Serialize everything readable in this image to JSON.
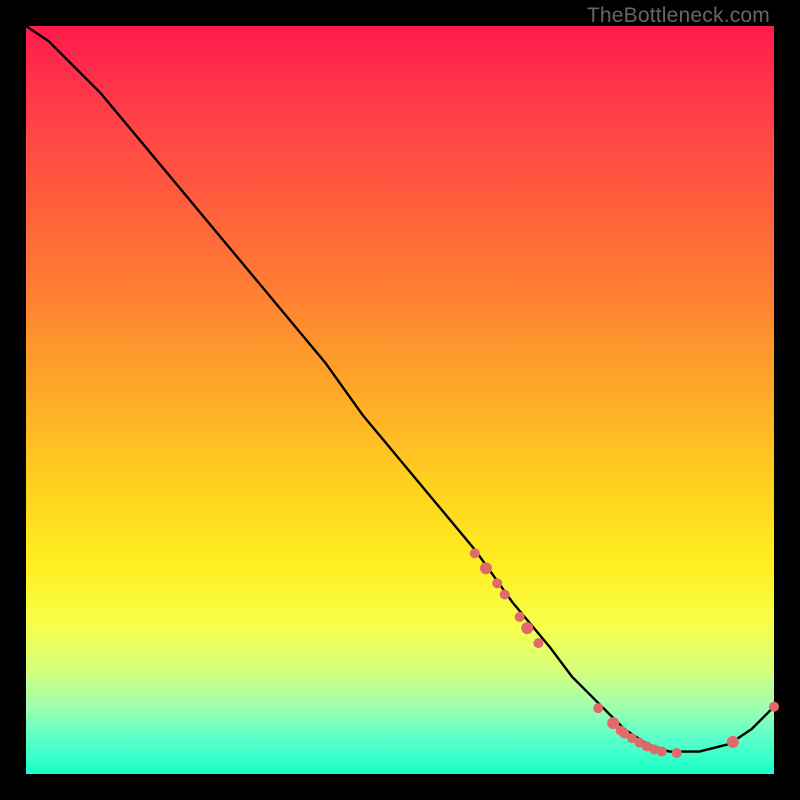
{
  "watermark": "TheBottleneck.com",
  "chart_data": {
    "type": "line",
    "title": "",
    "xlabel": "",
    "ylabel": "",
    "xlim": [
      0,
      100
    ],
    "ylim": [
      0,
      100
    ],
    "series": [
      {
        "name": "curve",
        "x": [
          0,
          3,
          6,
          10,
          15,
          20,
          25,
          30,
          35,
          40,
          45,
          50,
          55,
          60,
          65,
          70,
          73,
          76,
          80,
          83,
          86,
          90,
          94,
          97,
          100
        ],
        "y": [
          100,
          98,
          95,
          91,
          85,
          79,
          73,
          67,
          61,
          55,
          48,
          42,
          36,
          30,
          23,
          17,
          13,
          10,
          6,
          4,
          3,
          3,
          4,
          6,
          9
        ]
      }
    ],
    "scatter_points": {
      "name": "markers",
      "color": "#e06a6a",
      "points": [
        {
          "x": 60.0,
          "y": 29.5,
          "r": 5
        },
        {
          "x": 61.5,
          "y": 27.5,
          "r": 6
        },
        {
          "x": 63.0,
          "y": 25.5,
          "r": 5
        },
        {
          "x": 64.0,
          "y": 24.0,
          "r": 5
        },
        {
          "x": 66.0,
          "y": 21.0,
          "r": 5
        },
        {
          "x": 67.0,
          "y": 19.5,
          "r": 6
        },
        {
          "x": 68.5,
          "y": 17.5,
          "r": 5
        },
        {
          "x": 76.5,
          "y": 8.8,
          "r": 5
        },
        {
          "x": 78.5,
          "y": 6.8,
          "r": 6
        },
        {
          "x": 79.5,
          "y": 5.8,
          "r": 5
        },
        {
          "x": 80.0,
          "y": 5.4,
          "r": 5
        },
        {
          "x": 81.0,
          "y": 4.8,
          "r": 5
        },
        {
          "x": 82.0,
          "y": 4.2,
          "r": 5
        },
        {
          "x": 83.0,
          "y": 3.7,
          "r": 5
        },
        {
          "x": 84.0,
          "y": 3.3,
          "r": 5
        },
        {
          "x": 85.0,
          "y": 3.0,
          "r": 5
        },
        {
          "x": 87.0,
          "y": 2.8,
          "r": 5
        },
        {
          "x": 94.5,
          "y": 4.3,
          "r": 6
        },
        {
          "x": 100.0,
          "y": 9.0,
          "r": 5
        }
      ]
    }
  }
}
